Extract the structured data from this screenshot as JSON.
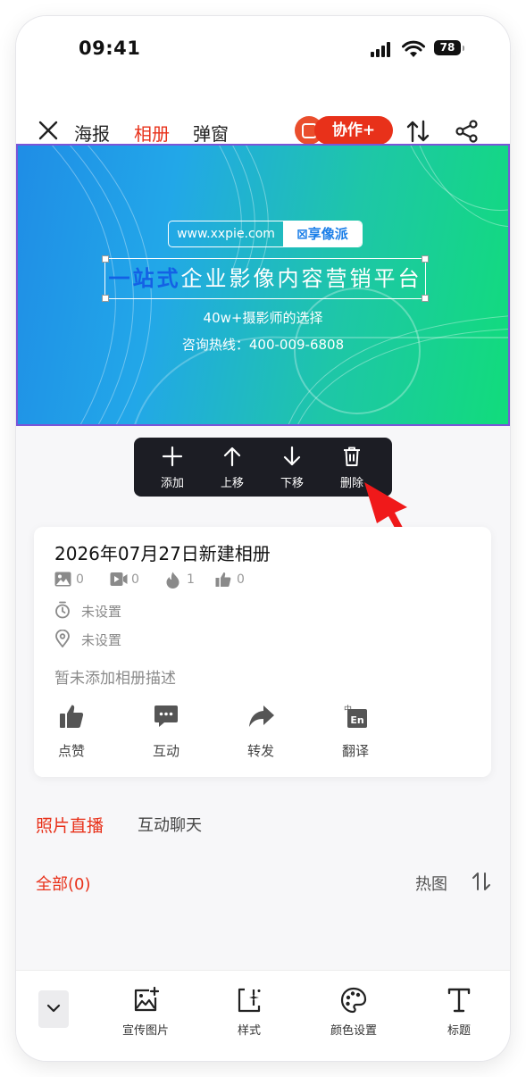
{
  "status_bar": {
    "time": "09:41",
    "battery": "78"
  },
  "nav": {
    "tabs": [
      {
        "label": "海报",
        "active": false
      },
      {
        "label": "相册",
        "active": true
      },
      {
        "label": "弹窗",
        "active": false
      }
    ],
    "collab_label": "协作+"
  },
  "banner": {
    "url": "www.xxpie.com",
    "brand": "享像派",
    "headline_highlight": "一站式",
    "headline_rest": "企业影像内容营销平台",
    "subline": "40w+摄影师的选择",
    "hotline": "咨询热线：400-009-6808"
  },
  "popup": {
    "add": "添加",
    "move_up": "上移",
    "move_down": "下移",
    "delete": "删除"
  },
  "album": {
    "title": "2026年07月27日新建相册",
    "stats": {
      "photos": "0",
      "videos": "0",
      "hot": "1",
      "likes": "0"
    },
    "time_setting": "未设置",
    "location_setting": "未设置",
    "description": "暂未添加相册描述",
    "actions": {
      "like": "点赞",
      "interact": "互动",
      "forward": "转发",
      "translate": "翻译"
    }
  },
  "sections": {
    "live": "照片直播",
    "chat": "互动聊天"
  },
  "filter": {
    "all": "全部(0)",
    "hot": "热图"
  },
  "bottom_bar": {
    "promo_image": "宣传图片",
    "style": "样式",
    "color_settings": "颜色设置",
    "title": "标题"
  },
  "colors": {
    "accent": "#e8311a",
    "popup_bg": "#1c1d24",
    "banner_border": "#7a55d8"
  }
}
